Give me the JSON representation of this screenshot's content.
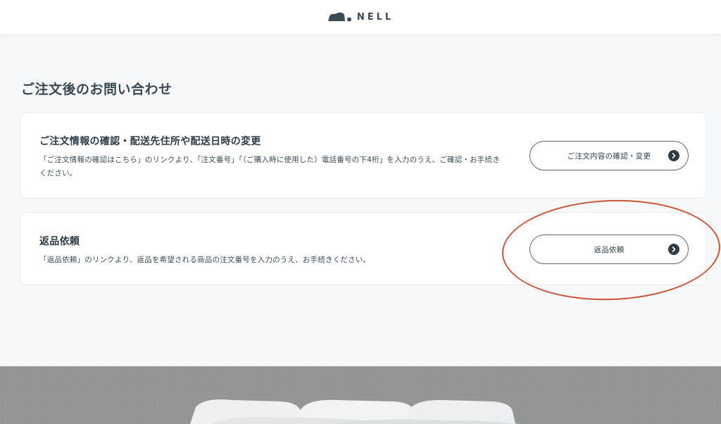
{
  "header": {
    "logo_text": "NELL",
    "logo_icon": "nell-logo-mark"
  },
  "main": {
    "title": "ご注文後のお問い合わせ",
    "cards": [
      {
        "heading": "ご注文情報の確認・配送先住所や配送日時の変更",
        "description": "「ご注文情報の確認はこちら」のリンクより、「注文番号」「（ご購入時に使用した）電話番号の下4桁」を入力のうえ、ご確認・お手続きください。",
        "button_label": "ご注文内容の確認・変更",
        "button_icon": "chevron-right-circle-icon"
      },
      {
        "heading": "返品依頼",
        "description": "「返品依頼」のリンクより、返品を希望される商品の注文番号を入力のうえ、お手続きください。",
        "button_label": "返品依頼",
        "button_icon": "chevron-right-circle-icon"
      }
    ]
  },
  "colors": {
    "page_bg": "#f7f8f9",
    "text": "#2d3a44",
    "card_border": "#e7eaec",
    "annotation": "#c8543a"
  }
}
